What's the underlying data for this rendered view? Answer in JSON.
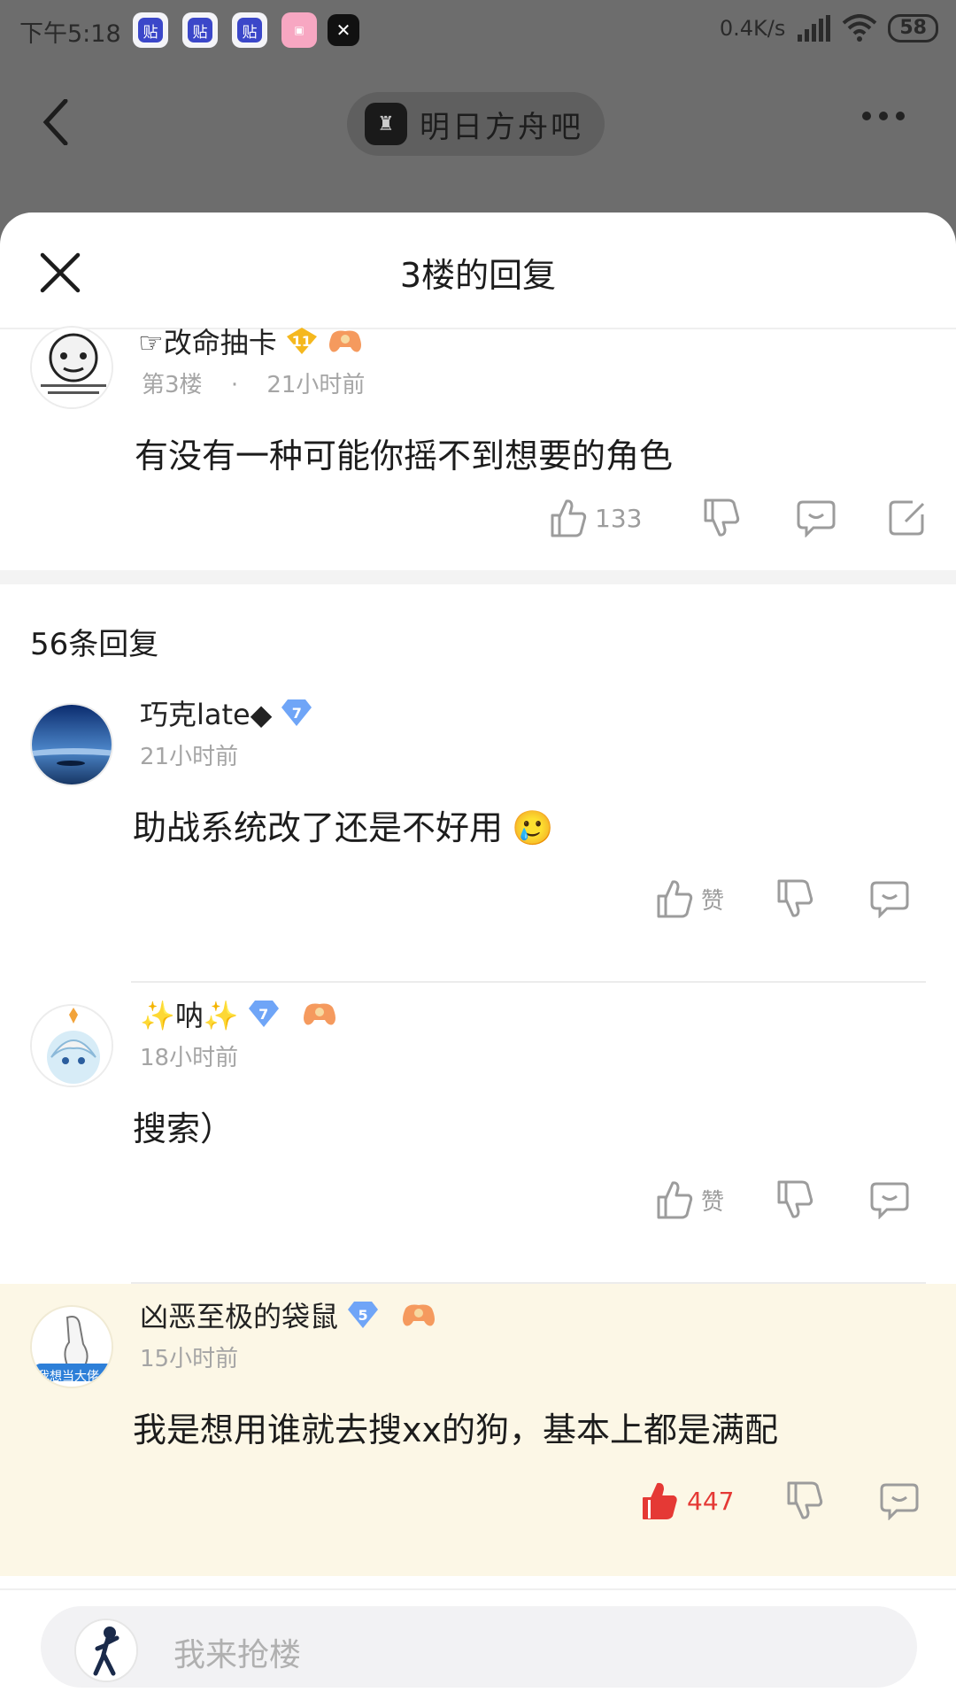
{
  "status_bar": {
    "time": "下午5:18",
    "app_icons": [
      "tieba-icon",
      "tieba-icon",
      "tieba-icon",
      "lofter-icon",
      "capcut-icon"
    ],
    "tieba_glyph": "贴",
    "speed": "0.4K/s",
    "battery": "58"
  },
  "background_page": {
    "forum_name": "明日方舟吧"
  },
  "sheet": {
    "title": "3楼的回复",
    "op": {
      "username": "☞改命抽卡",
      "level": "11",
      "level_color": "#f5b81e",
      "floor": "第3楼",
      "sep": "·",
      "time": "21小时前",
      "text": "有没有一种可能你摇不到想要的角色",
      "likes": "133"
    },
    "reply_count": "56条回复",
    "replies": [
      {
        "username": "巧克late◆",
        "level": "7",
        "level_color": "#6fa5f7",
        "time": "21小时前",
        "text": "助战系统改了还是不好用",
        "emoji": "🥲",
        "like_label": "赞",
        "liked": false,
        "game_badge": false
      },
      {
        "username": "✨呐✨",
        "level": "7",
        "level_color": "#6fa5f7",
        "time": "18小时前",
        "text": "搜索）",
        "emoji": "",
        "like_label": "赞",
        "liked": false,
        "game_badge": true
      },
      {
        "username": "凶恶至极的袋鼠",
        "level": "5",
        "level_color": "#6fa5f7",
        "time": "15小时前",
        "text": "我是想用谁就去搜xx的狗，基本上都是满配",
        "emoji": "",
        "like_label": "447",
        "liked": true,
        "game_badge": true,
        "avatar_caption": "我想当大佬"
      }
    ]
  },
  "input_bar": {
    "placeholder": "我来抢楼"
  },
  "colors": {
    "like_active": "#e53935",
    "highlight_bg": "#fcf7e6",
    "overlay": "#6d6d6d"
  }
}
